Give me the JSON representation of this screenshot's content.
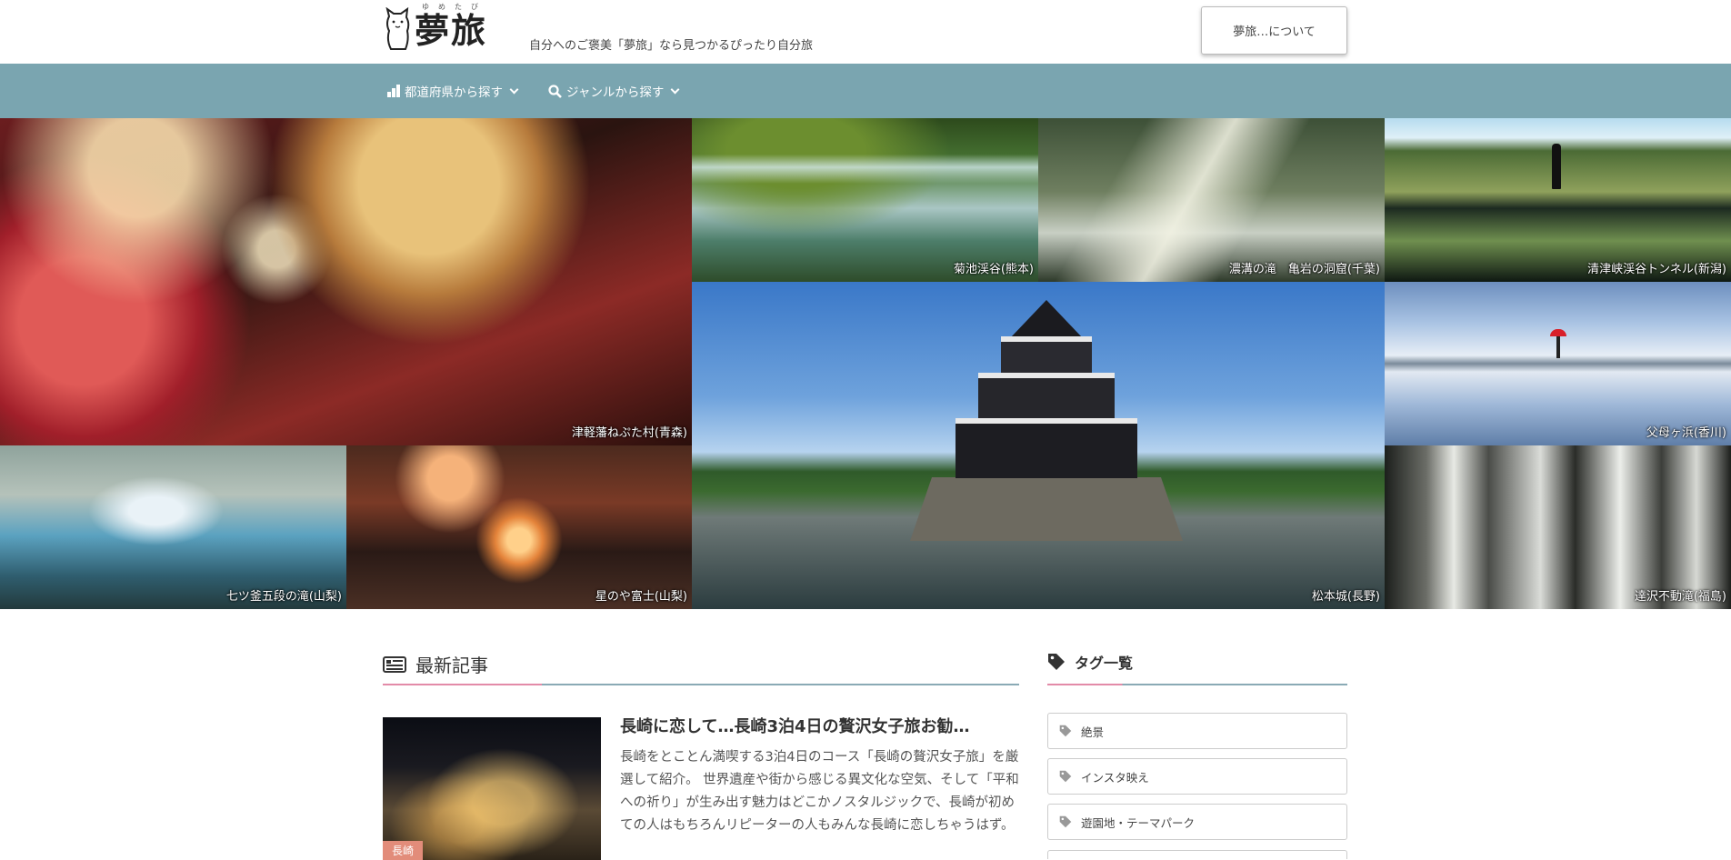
{
  "header": {
    "logo_text": "夢旅",
    "logo_ruby": "ゆめたび",
    "tagline": "自分へのご褒美「夢旅」なら見つかるぴったり自分旅",
    "about_label": "夢旅…について"
  },
  "nav": {
    "items": [
      {
        "label": "都道府県から探す",
        "icon": "building-icon"
      },
      {
        "label": "ジャンルから探す",
        "icon": "search-icon"
      }
    ]
  },
  "gallery": {
    "tiles": [
      {
        "caption": "津軽藩ねぷた村(青森)"
      },
      {
        "caption": "菊池渓谷(熊本)"
      },
      {
        "caption": "濃溝の滝　亀岩の洞窟(千葉)"
      },
      {
        "caption": "清津峡渓谷トンネル(新潟)"
      },
      {
        "caption": "父母ヶ浜(香川)"
      },
      {
        "caption": "松本城(長野)"
      },
      {
        "caption": "七ツ釜五段の滝(山梨)"
      },
      {
        "caption": "星のや富士(山梨)"
      },
      {
        "caption": "達沢不動滝(福島)"
      }
    ]
  },
  "latest": {
    "heading": "最新記事",
    "articles": [
      {
        "title": "長崎に恋して…長崎3泊4日の贅沢女子旅お勧…",
        "excerpt": "長崎をとことん満喫する3泊4日のコース「長崎の贅沢女子旅」を厳選して紹介。 世界遺産や街から感じる異文化な空気、そして「平和への祈り」が生み出す魅力はどこかノスタルジックで、長崎が初めての人はもちろんリピーターの人もみんな長崎に恋しちゃうはず。",
        "category": "長崎"
      }
    ]
  },
  "sidebar": {
    "heading": "タグ一覧",
    "tags": [
      "絶景",
      "インスタ映え",
      "遊園地・テーマパーク"
    ]
  },
  "colors": {
    "nav_bg": "#7aa5b0",
    "accent_pink": "#e38ba8",
    "category_badge": "#e28c7a"
  }
}
